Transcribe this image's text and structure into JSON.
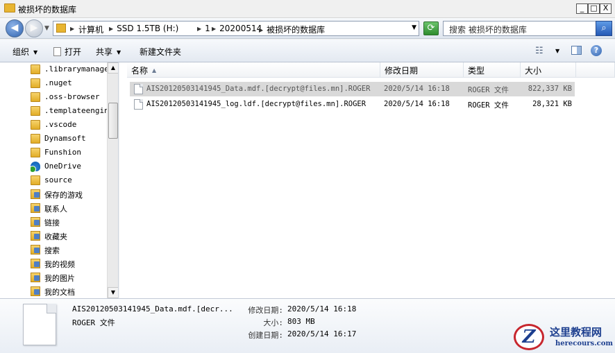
{
  "window": {
    "title": "被损坏的数据库",
    "min_label": "_",
    "max_label": "□",
    "close_label": "X"
  },
  "address": {
    "crumbs": [
      "计算机",
      "SSD 1.5TB (H:)",
      "1",
      "20200514",
      "被损坏的数据库"
    ]
  },
  "search": {
    "placeholder": "搜索 被损坏的数据库"
  },
  "toolbar": {
    "organize": "组织",
    "open": "打开",
    "share": "共享",
    "new_folder": "新建文件夹"
  },
  "nav": {
    "items": [
      {
        "label": ".librarymanager",
        "icon": "folder-icon"
      },
      {
        "label": ".nuget",
        "icon": "folder-icon"
      },
      {
        "label": ".oss-browser",
        "icon": "folder-icon"
      },
      {
        "label": ".templateengine",
        "icon": "folder-icon"
      },
      {
        "label": ".vscode",
        "icon": "folder-icon"
      },
      {
        "label": "Dynamsoft",
        "icon": "folder-icon"
      },
      {
        "label": "Funshion",
        "icon": "folder-icon"
      },
      {
        "label": "OneDrive",
        "icon": "onedrive-icon"
      },
      {
        "label": "source",
        "icon": "folder-icon"
      },
      {
        "label": "保存的游戏",
        "icon": "saved-games-icon"
      },
      {
        "label": "联系人",
        "icon": "contacts-icon"
      },
      {
        "label": "链接",
        "icon": "links-icon"
      },
      {
        "label": "收藏夹",
        "icon": "favorites-icon"
      },
      {
        "label": "搜索",
        "icon": "searches-icon"
      },
      {
        "label": "我的视频",
        "icon": "videos-icon"
      },
      {
        "label": "我的图片",
        "icon": "pictures-icon"
      },
      {
        "label": "我的文档",
        "icon": "documents-icon"
      }
    ]
  },
  "columns": {
    "name": "名称",
    "modified": "修改日期",
    "type": "类型",
    "size": "大小"
  },
  "files": [
    {
      "name": "AIS20120503141945_Data.mdf.[decrypt@files.mn].ROGER",
      "modified": "2020/5/14 16:18",
      "type": "ROGER 文件",
      "size": "822,337 KB"
    },
    {
      "name": "AIS20120503141945_log.ldf.[decrypt@files.mn].ROGER",
      "modified": "2020/5/14 16:18",
      "type": "ROGER 文件",
      "size": "28,321 KB"
    }
  ],
  "details": {
    "name": "AIS20120503141945_Data.mdf.[decr...",
    "type": "ROGER 文件",
    "modified_label": "修改日期:",
    "modified": "2020/5/14 16:18",
    "size_label": "大小:",
    "size": "803 MB",
    "created_label": "创建日期:",
    "created": "2020/5/14 16:17"
  },
  "watermark": {
    "logo_letter": "Z",
    "cn": "这里教程网",
    "en": "herecours.com"
  }
}
